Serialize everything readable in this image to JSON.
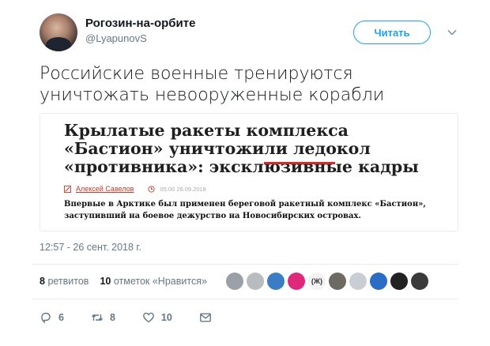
{
  "user": {
    "name": "Рогозин-на-орбите",
    "handle": "@LyapunovS",
    "follow_label": "Читать"
  },
  "tweet": {
    "text": "Российские военные тренируются уничтожать невооруженные корабли",
    "timestamp": "12:57 - 26 сент. 2018 г."
  },
  "card": {
    "headline": "Крылатые ракеты комплекса «Бастион» уничтожили ледокол «противника»: эксклюзивные кадры",
    "author": "Алексей Савелов",
    "date": "05:00 26.09.2018",
    "body": "Впервые в Арктике был применен береговой ракетный комплекс «Бастион», заступивший на боевое дежурство на Новосибирских островах."
  },
  "stats": {
    "retweets_count": "8",
    "retweets_label": "ретвитов",
    "likes_count": "10",
    "likes_label": "отметок «Нравится»",
    "face_text": "(Ж)"
  },
  "actions": {
    "replies": "6",
    "retweets": "8",
    "likes": "10"
  },
  "colors": {
    "accent": "#1da1f2",
    "muted": "#657786",
    "headline_underline": "#d42a2a"
  }
}
